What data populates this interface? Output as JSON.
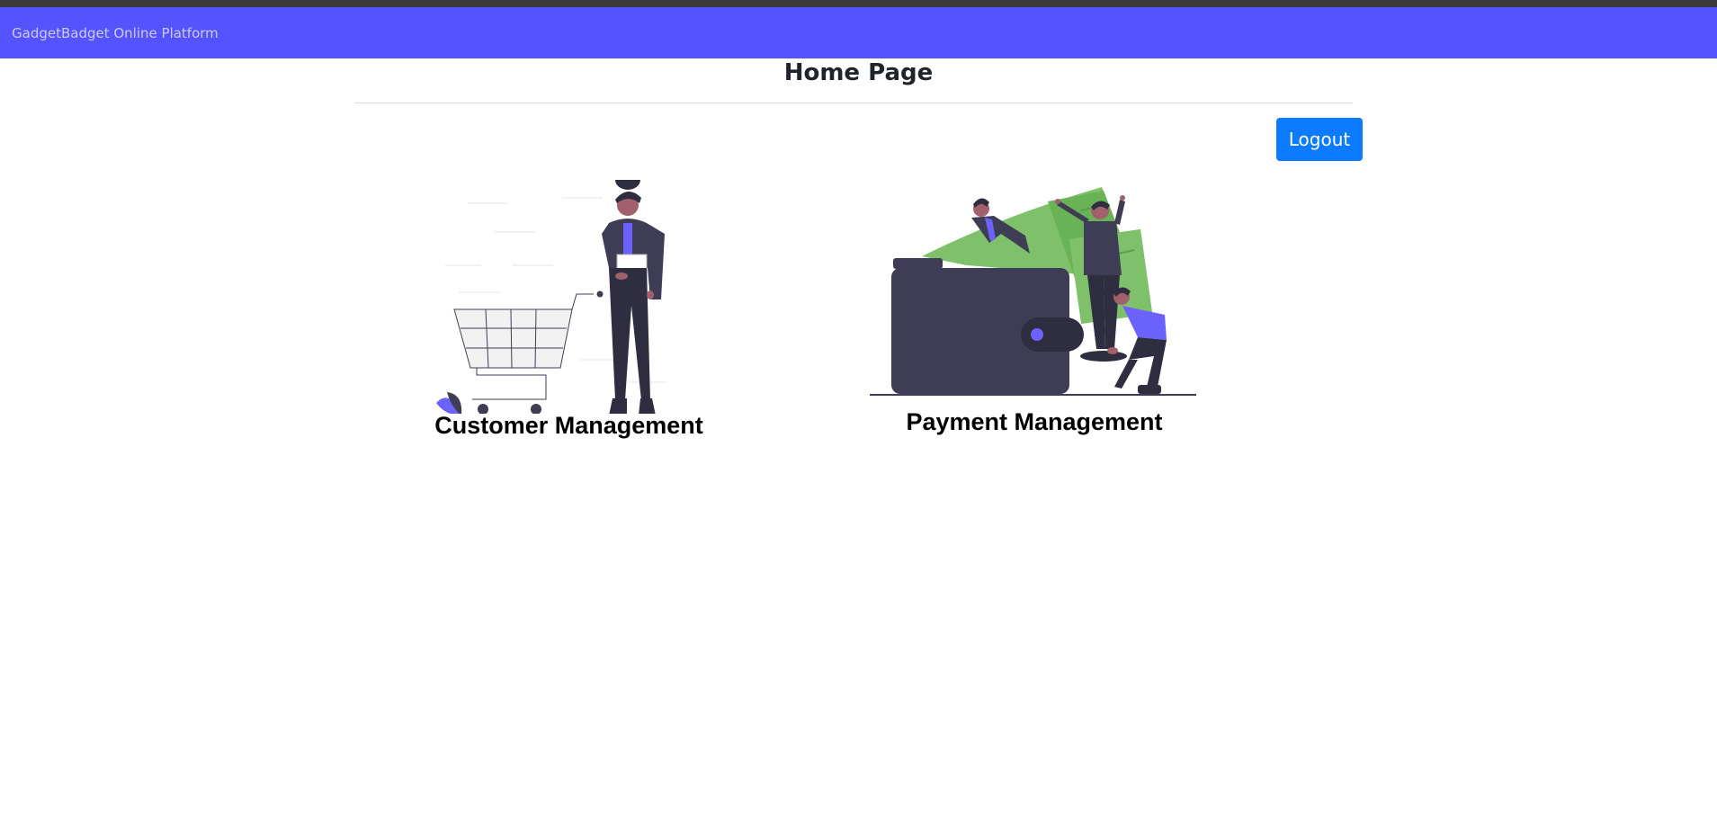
{
  "navbar": {
    "brand": "GadgetBadget Online Platform"
  },
  "page": {
    "title": "Home Page"
  },
  "actions": {
    "logout_label": "Logout"
  },
  "cards": [
    {
      "id": "customer",
      "label": "Customer Management",
      "icon": "shopping-cart-illustration"
    },
    {
      "id": "payment",
      "label": "Payment Management",
      "icon": "wallet-money-illustration"
    }
  ],
  "colors": {
    "navbar": "#5454ff",
    "accent": "#6c63ff",
    "button": "#0d7bff",
    "money": "#7ec16a",
    "dark": "#3f3d56"
  }
}
